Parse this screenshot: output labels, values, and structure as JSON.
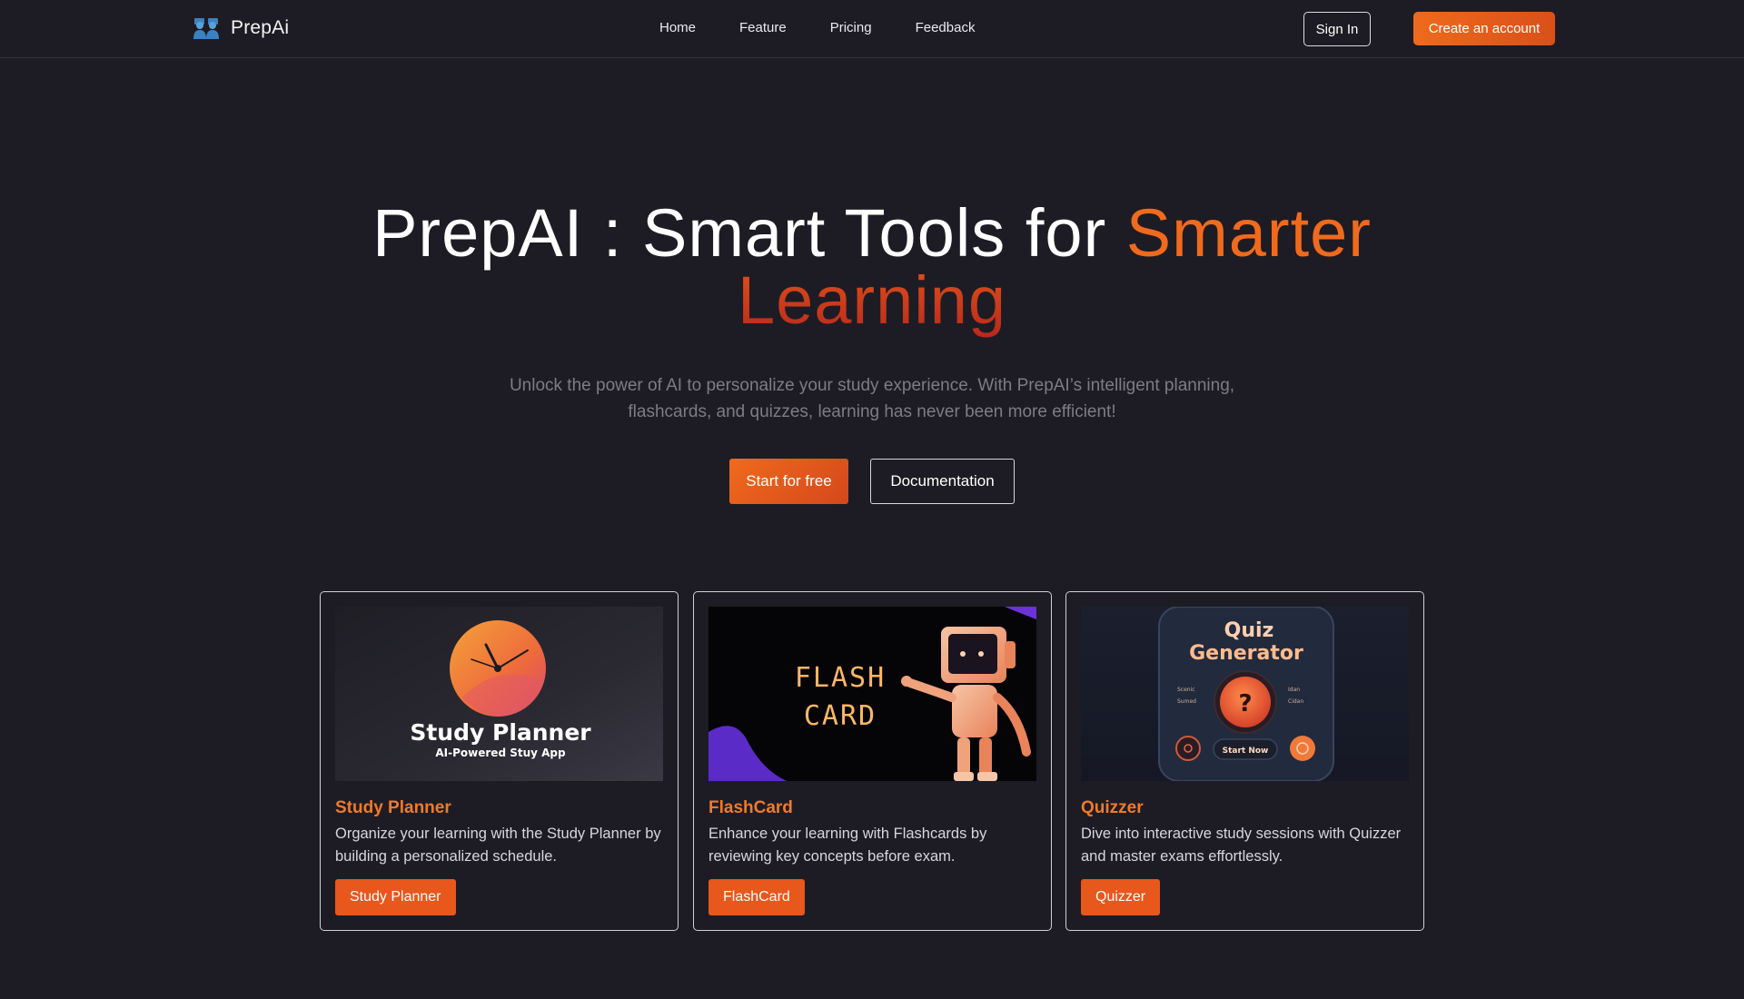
{
  "nav": {
    "brand": "PrepAi",
    "links": [
      "Home",
      "Feature",
      "Pricing",
      "Feedback"
    ],
    "signin_label": "Sign In",
    "create_label": "Create an account"
  },
  "hero": {
    "title_part1": "PrepAI : Smart Tools for ",
    "title_accent": "Smarter",
    "title_accent2": "Learning",
    "subtitle": "Unlock the power of AI to personalize your study experience. With PrepAI’s intelligent planning, flashcards, and quizzes, learning has never been more efficient!",
    "start_label": "Start for free",
    "docs_label": "Documentation"
  },
  "cards": [
    {
      "title": "Study Planner",
      "desc": "Organize your learning with the Study Planner by building a personalized schedule.",
      "button": "Study Planner",
      "img_title": "Study Planner",
      "img_sub": "AI-Powered Stuy App"
    },
    {
      "title": "FlashCard",
      "desc": "Enhance your learning with Flashcards by reviewing key concepts before exam.",
      "button": "FlashCard",
      "img_line1": "FLASH",
      "img_line2": "CARD"
    },
    {
      "title": "Quizzer",
      "desc": "Dive into interactive study sessions with Quizzer and master exams effortlessly.",
      "button": "Quizzer",
      "img_title1": "Quiz",
      "img_title2": "Generator",
      "img_start": "Start Now",
      "img_left1": "Scenic",
      "img_left2": "Sumed",
      "img_right1": "Idan",
      "img_right2": "Cidan",
      "img_q": "?"
    }
  ],
  "colors": {
    "background": "#1d1c24",
    "accent": "#f06a1e",
    "accent_dark": "#b9281d",
    "button": "#e8571b"
  }
}
